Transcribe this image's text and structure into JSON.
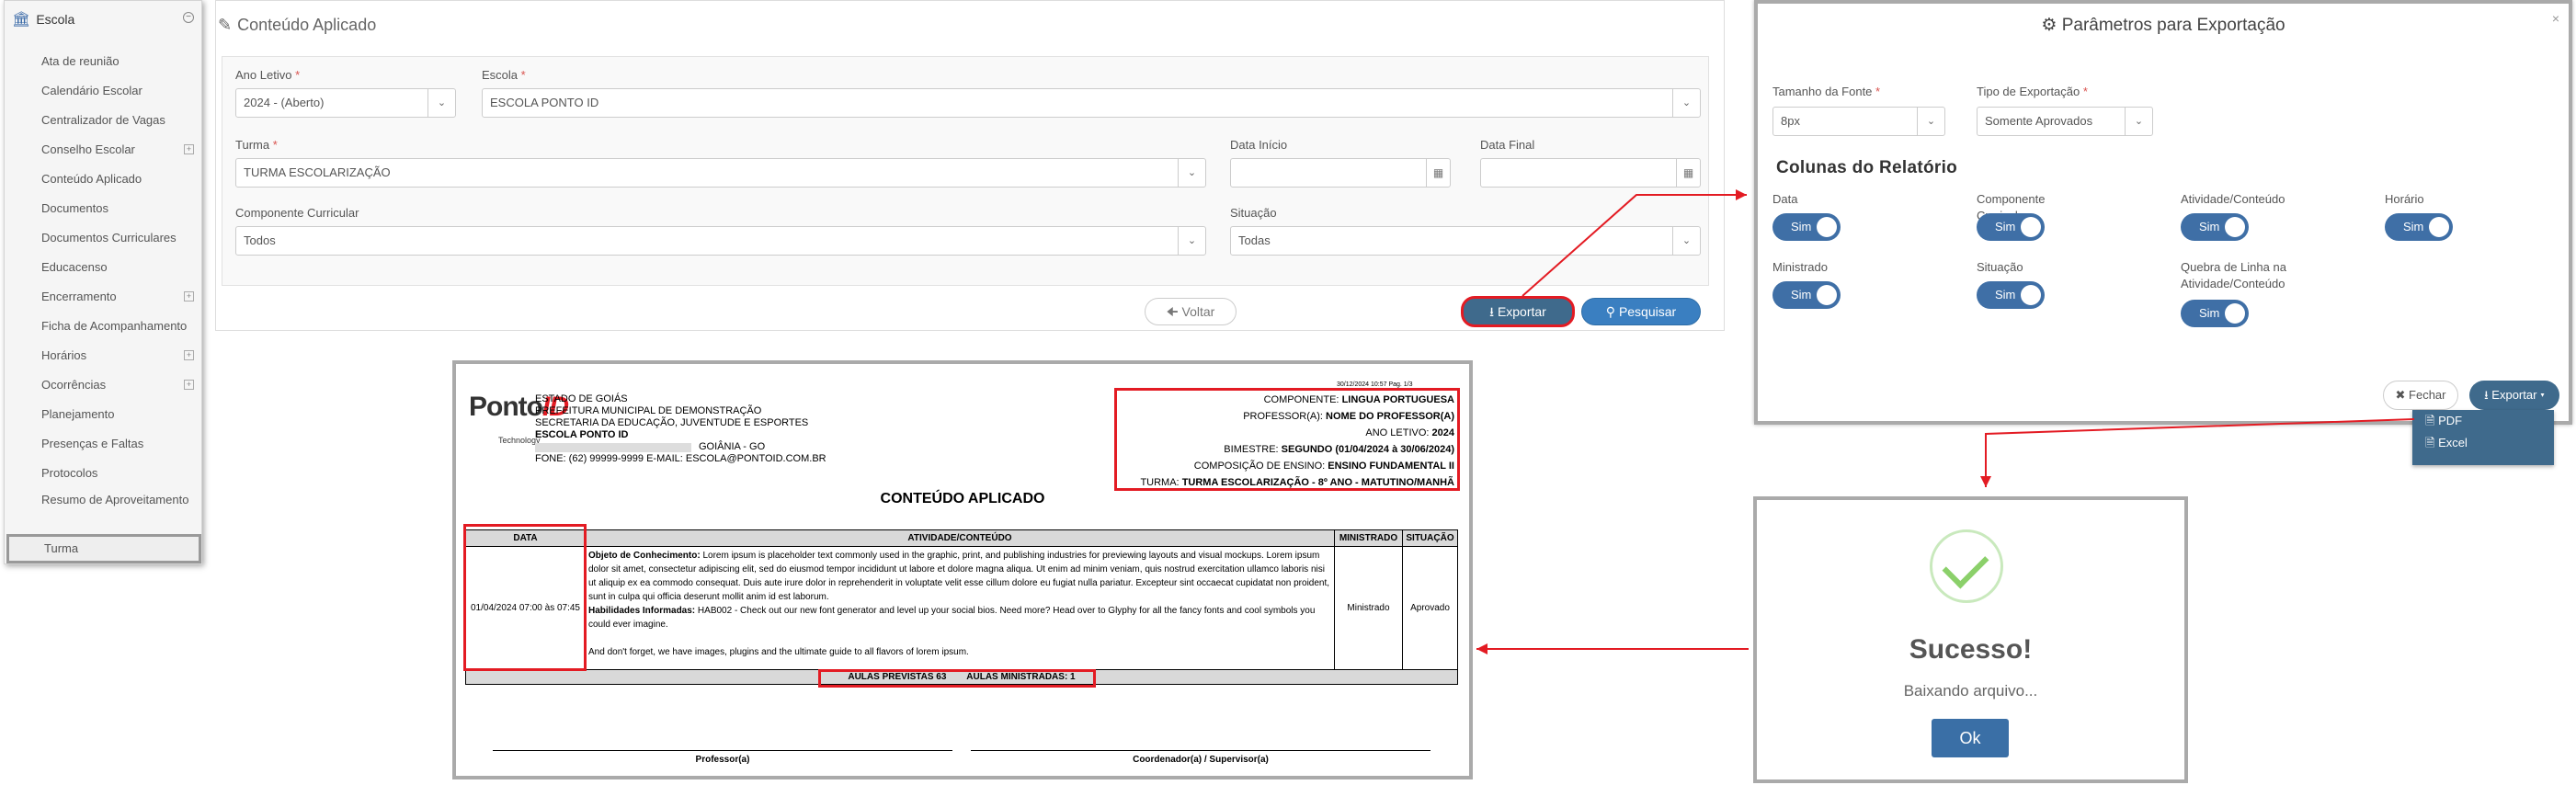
{
  "sidebar": {
    "title": "Escola",
    "items": [
      {
        "label": "Ata de reunião",
        "expand": false
      },
      {
        "label": "Calendário Escolar",
        "expand": false
      },
      {
        "label": "Centralizador de Vagas",
        "expand": false
      },
      {
        "label": "Conselho Escolar",
        "expand": true
      },
      {
        "label": "Conteúdo Aplicado",
        "expand": false
      },
      {
        "label": "Documentos",
        "expand": false
      },
      {
        "label": "Documentos Curriculares",
        "expand": false
      },
      {
        "label": "Educacenso",
        "expand": false
      },
      {
        "label": "Encerramento",
        "expand": true
      },
      {
        "label": "Ficha de Acompanhamento",
        "expand": false
      },
      {
        "label": "Horários",
        "expand": true
      },
      {
        "label": "Ocorrências",
        "expand": true
      },
      {
        "label": "Planejamento",
        "expand": false
      },
      {
        "label": "Presenças e Faltas",
        "expand": false
      },
      {
        "label": "Protocolos",
        "expand": false
      },
      {
        "label": "Resumo de Aproveitamento",
        "expand": false
      }
    ],
    "active": "Turma"
  },
  "form": {
    "title": "Conteúdo Aplicado",
    "ano_letivo_label": "Ano Letivo",
    "ano_letivo_value": "2024 - (Aberto)",
    "escola_label": "Escola",
    "escola_value": "ESCOLA PONTO ID",
    "turma_label": "Turma",
    "turma_value": "TURMA ESCOLARIZAÇÃO",
    "data_inicio_label": "Data Início",
    "data_final_label": "Data Final",
    "componente_label": "Componente Curricular",
    "componente_value": "Todos",
    "situacao_label": "Situação",
    "situacao_value": "Todas",
    "required_mark": "*",
    "voltar": "Voltar",
    "exportar": "Exportar",
    "pesquisar": "Pesquisar"
  },
  "modal": {
    "title": "Parâmetros para Exportação",
    "fonte_label": "Tamanho da Fonte",
    "fonte_value": "8px",
    "tipo_label": "Tipo de Exportação",
    "tipo_value": "Somente Aprovados",
    "section": "Colunas do Relatório",
    "columns": [
      {
        "label": "Data",
        "value": "Sim"
      },
      {
        "label": "Componente Curricular",
        "value": "Sim"
      },
      {
        "label": "Atividade/Conteúdo",
        "value": "Sim"
      },
      {
        "label": "Horário",
        "value": "Sim"
      },
      {
        "label": "Ministrado",
        "value": "Sim"
      },
      {
        "label": "Situação",
        "value": "Sim"
      },
      {
        "label": "Quebra de Linha na Atividade/Conteúdo",
        "value": "Sim"
      }
    ],
    "fechar": "Fechar",
    "exportar": "Exportar",
    "dropdown": [
      "PDF",
      "Excel"
    ]
  },
  "success": {
    "title": "Sucesso!",
    "message": "Baixando arquivo...",
    "ok": "Ok"
  },
  "report": {
    "timestamp": "30/12/2024 10:57   Pag. 1/3",
    "logo_text": "Ponto",
    "logo_id": "ID",
    "logo_sub": "Technology",
    "header_lines": [
      "ESTADO DE GOIÁS",
      "PREFEITURA MUNICIPAL DE DEMONSTRAÇÃO",
      "SECRETARIA DA EDUCAÇÃO, JUVENTUDE E ESPORTES",
      "ESCOLA PONTO ID"
    ],
    "city": "GOIÂNIA - GO",
    "contact": "FONE: (62) 99999-9999 E-MAIL: ESCOLA@PONTOID.COM.BR",
    "info": [
      {
        "k": "COMPONENTE:",
        "v": "LINGUA PORTUGUESA"
      },
      {
        "k": "PROFESSOR(A):",
        "v": "NOME DO PROFESSOR(A)"
      },
      {
        "k": "ANO LETIVO:",
        "v": "2024"
      },
      {
        "k": "BIMESTRE:",
        "v": "SEGUNDO (01/04/2024 à 30/06/2024)"
      },
      {
        "k": "COMPOSIÇÃO DE ENSINO:",
        "v": "ENSINO FUNDAMENTAL II"
      },
      {
        "k": "TURMA:",
        "v": "TURMA ESCOLARIZAÇÃO - 8º ANO - MATUTINO/MANHÃ"
      }
    ],
    "title": "CONTEÚDO APLICADO",
    "columns": [
      "DATA",
      "ATIVIDADE/CONTEÚDO",
      "MINISTRADO",
      "SITUAÇÃO"
    ],
    "row": {
      "data": "01/04/2024 07:00 às 07:45",
      "obj_label": "Objeto de Conhecimento:",
      "obj_text": "Lorem ipsum is placeholder text commonly used in the graphic, print, and publishing industries for previewing layouts and visual mockups. Lorem ipsum dolor sit amet, consectetur adipiscing elit, sed do eiusmod tempor incididunt ut labore et dolore magna aliqua. Ut enim ad minim veniam, quis nostrud exercitation ullamco laboris nisi ut aliquip ex ea commodo consequat. Duis aute irure dolor in reprehenderit in voluptate velit esse cillum dolore eu fugiat nulla pariatur. Excepteur sint occaecat cupidatat non proident, sunt in culpa qui officia deserunt mollit anim id est laborum.",
      "hab_label": "Habilidades Informadas:",
      "hab_text": "HAB002 - Check out our new font generator and level up your social bios. Need more? Head over to Glyphy for all the fancy fonts and cool symbols you could ever imagine.",
      "extra": "And don't forget, we have images, plugins and the ultimate guide to all flavors of lorem ipsum.",
      "ministrado": "Ministrado",
      "situacao": "Aprovado"
    },
    "totals": "AULAS PREVISTAS 63        AULAS MINISTRADAS: 1",
    "sign_prof": "Professor(a)",
    "sign_coord": "Coordenador(a) / Supervisor(a)"
  }
}
